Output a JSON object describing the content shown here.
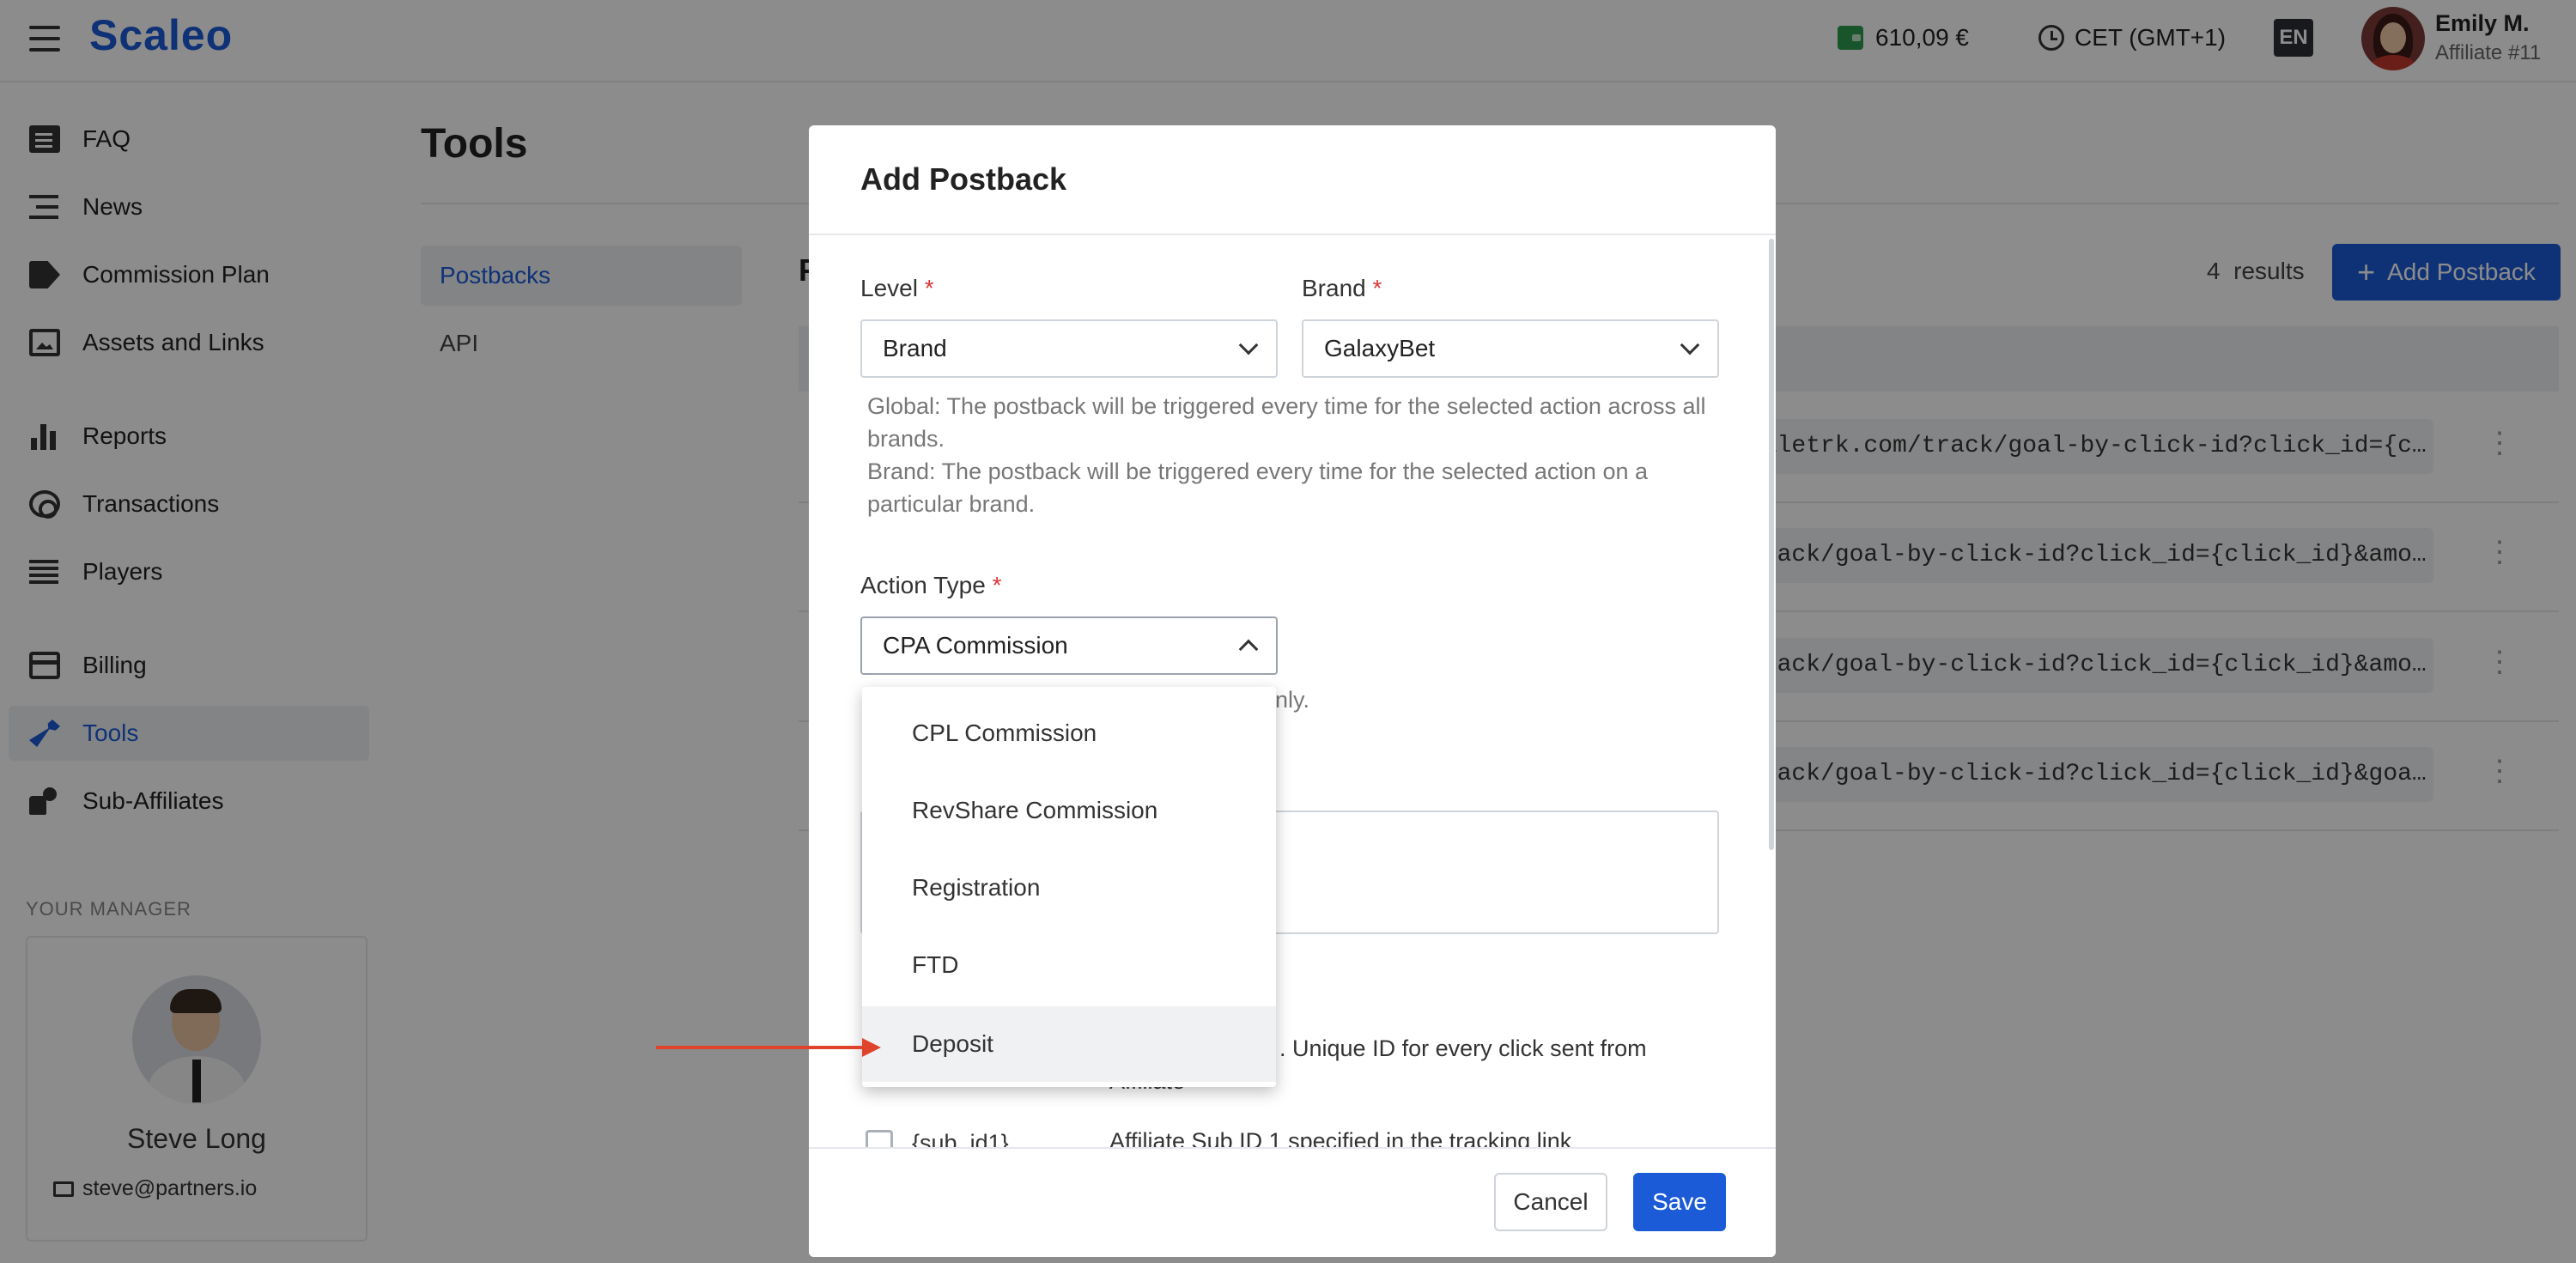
{
  "header": {
    "logo": "Scaleo",
    "balance": "610,09 €",
    "timezone": "CET (GMT+1)",
    "language": "EN",
    "user_name": "Emily M.",
    "user_sub": "Affiliate #11"
  },
  "sidebar": {
    "items": [
      {
        "label": "FAQ",
        "icon": "faq-icon"
      },
      {
        "label": "News",
        "icon": "news-icon"
      },
      {
        "label": "Commission Plan",
        "icon": "tag-icon"
      },
      {
        "label": "Assets and Links",
        "icon": "image-icon"
      },
      {
        "label": "Reports",
        "icon": "bar-chart-icon"
      },
      {
        "label": "Transactions",
        "icon": "radar-icon"
      },
      {
        "label": "Players",
        "icon": "list-icon"
      },
      {
        "label": "Billing",
        "icon": "card-icon"
      },
      {
        "label": "Tools",
        "icon": "wrench-icon"
      },
      {
        "label": "Sub-Affiliates",
        "icon": "sub-affiliates-icon"
      }
    ],
    "manager_label": "YOUR MANAGER",
    "manager_name": "Steve Long",
    "manager_email": "steve@partners.io"
  },
  "page": {
    "title": "Tools",
    "subnav_active": "Postbacks",
    "subnav_other": "API",
    "results_count": "4",
    "results_label": "results",
    "add_button": "Add Postback",
    "table_partial_header": "P",
    "rows": [
      "caletrk.com/track/goal-by-click-id?click_id={c…",
      "track/goal-by-click-id?click_id={click_id}&amo…",
      "track/goal-by-click-id?click_id={click_id}&amo…",
      "track/goal-by-click-id?click_id={click_id}&goa…"
    ]
  },
  "modal": {
    "title": "Add Postback",
    "level_label": "Level",
    "level_value": "Brand",
    "brand_label": "Brand",
    "brand_value": "GalaxyBet",
    "required_mark": "*",
    "help_global": "Global: The postback will be triggered every time for the selected action across all brands.",
    "help_brand": "Brand: The postback will be triggered every time for the selected action on a particular brand.",
    "action_type_label": "Action Type",
    "action_type_value": "CPA Commission",
    "partial_hint": "only.",
    "param_desc_1_partial": ". Unique ID for every click sent from",
    "param_desc_1_partial_2": "Affiliate",
    "param_2_name": "{sub_id1}",
    "param_2_desc": "Affiliate Sub ID 1 specified in the tracking link",
    "cancel_label": "Cancel",
    "save_label": "Save"
  },
  "dropdown": {
    "options": [
      "CPL Commission",
      "RevShare Commission",
      "Registration",
      "FTD",
      "Deposit"
    ],
    "highlighted": "Deposit"
  },
  "colors": {
    "accent": "#1c5bd8",
    "annotation_arrow": "#e0432b",
    "required": "#d9383a"
  }
}
